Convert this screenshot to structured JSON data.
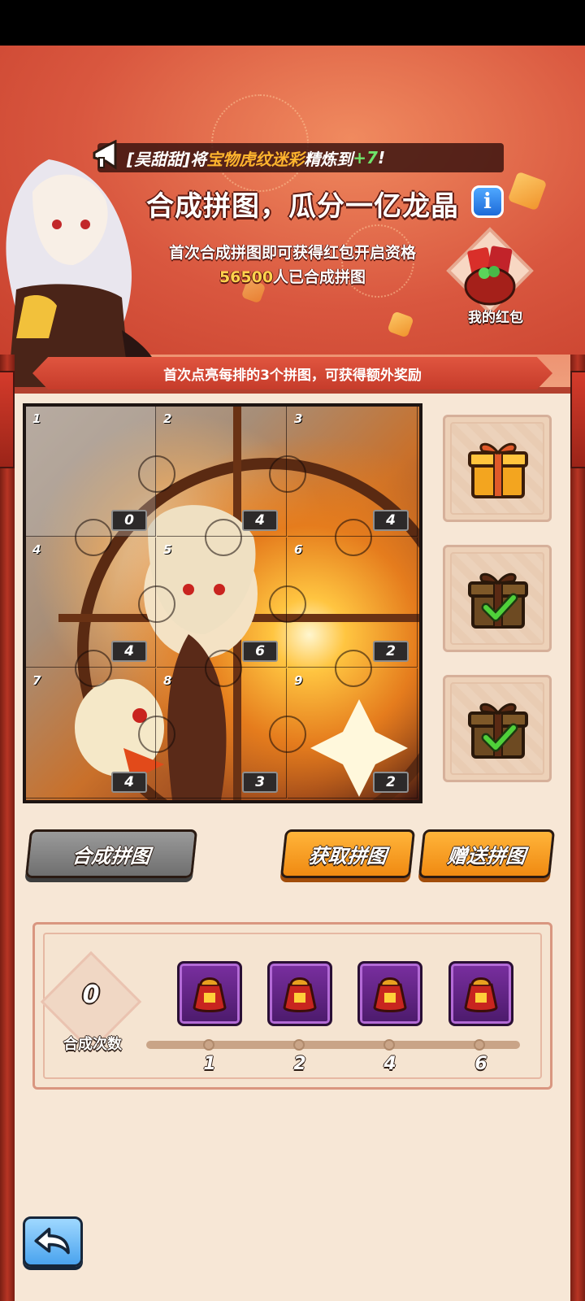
{
  "ticker": {
    "player": "[吴甜甜]",
    "action": "将",
    "item": "宝物虎纹迷彩",
    "verb": "精炼到",
    "level": "+7",
    "end": "!"
  },
  "header": {
    "title": "合成拼图，瓜分一亿龙晶",
    "info_label": "i",
    "subtitle": "首次合成拼图即可获得红包开启资格",
    "people_count": "56500",
    "people_suffix": "人已合成拼图"
  },
  "my_redpack": {
    "label": "我的红包"
  },
  "banner": {
    "text": "首次点亮每排的3个拼图，可获得额外奖励"
  },
  "puzzle": {
    "pieces": [
      {
        "index": "1",
        "count": "0"
      },
      {
        "index": "2",
        "count": "4"
      },
      {
        "index": "3",
        "count": "4"
      },
      {
        "index": "4",
        "count": "4"
      },
      {
        "index": "5",
        "count": "6"
      },
      {
        "index": "6",
        "count": "2"
      },
      {
        "index": "7",
        "count": "4"
      },
      {
        "index": "8",
        "count": "3"
      },
      {
        "index": "9",
        "count": "2"
      }
    ]
  },
  "row_rewards": [
    {
      "state": "available",
      "icon": "gold-gift-icon"
    },
    {
      "state": "claimed",
      "icon": "claimed-gift-icon"
    },
    {
      "state": "claimed",
      "icon": "claimed-gift-icon"
    }
  ],
  "buttons": {
    "compose": "合成拼图",
    "get": "获取拼图",
    "gift": "赠送拼图"
  },
  "progress": {
    "count": "0",
    "count_label": "合成次数",
    "tiers": [
      "1",
      "2",
      "4",
      "6"
    ]
  },
  "colors": {
    "accent": "#f08a12",
    "banner_red": "#c63c2b",
    "check_green": "#4fd13a"
  }
}
